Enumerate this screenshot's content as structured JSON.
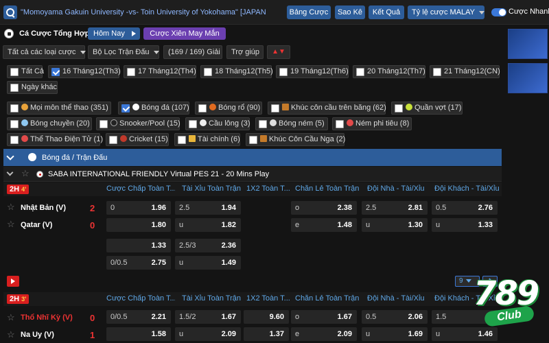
{
  "top": {
    "search_value": "\"Momoyama Gakuin University -vs- Toin University of Yokohama\" [JAPAN",
    "btn_bangcuoc": "Bảng Cược",
    "btn_saoke": "Sao Kê",
    "btn_ketqua": "Kết Quả",
    "btn_tyle": "Tỷ lệ cược MALAY",
    "toggle_label": "Cược Nhanh"
  },
  "menu": {
    "title": "Cá Cược Tổng Hợp",
    "today": "Hôm Nay",
    "parlay": "Cược Xiên May Mắn"
  },
  "filters": {
    "bet_types": "Tất cả các loại cược",
    "match_filter": "Bộ Lọc Trận Đấu",
    "count": "(169 / 169) Giải",
    "help": "Trợ giúp"
  },
  "dates": [
    "Tất Cả",
    "16 Tháng12(Th3)",
    "17 Tháng12(Th4)",
    "18 Tháng12(Th5)",
    "19 Tháng12(Th6)",
    "20 Tháng12(Th7)",
    "21 Tháng12(CN)",
    "Ngày khác"
  ],
  "sports": [
    "Mọi môn thể thao (351)",
    "Bóng đá (107)",
    "Bóng rổ (90)",
    "Khúc côn cầu trên băng (62)",
    "Quần vợt (17)",
    "Bóng chuyền (20)",
    "Snooker/Pool (15)",
    "Cầu lông (3)",
    "Bóng ném (5)",
    "Ném phi tiêu (8)",
    "Thể Thao Điện Tử (1)",
    "Cricket (15)",
    "Tài chính (6)",
    "Khúc Côn Cầu Nga (2)"
  ],
  "section": "Bóng đá / Trận Đấu",
  "league": "SABA INTERNATIONAL FRIENDLY Virtual PES 21 - 20 Mins Play",
  "columns": [
    "Cược Chấp Toàn T...",
    "Tài Xỉu Toàn Trận",
    "1X2 Toàn T...",
    "Chẵn Lẻ Toàn Trận",
    "Đội Nhà - Tài/Xỉu",
    "Đội Khách - Tài/Xỉu"
  ],
  "match1": {
    "status": "2H",
    "minute": "4'",
    "home": "Nhật Bản (V)",
    "away": "Qatar (V)",
    "home_score": "2",
    "away_score": "0",
    "r1": [
      [
        "0",
        "1.96"
      ],
      [
        "2.5",
        "1.94"
      ],
      [
        "o",
        "2.38"
      ],
      [
        "2.5",
        "2.81"
      ],
      [
        "0.5",
        "2.76"
      ]
    ],
    "r2": [
      [
        "",
        "1.80"
      ],
      [
        "u",
        "1.82"
      ],
      [
        "e",
        "1.48"
      ],
      [
        "u",
        "1.30"
      ],
      [
        "u",
        "1.33"
      ]
    ],
    "r3": [
      [
        "",
        "1.33"
      ],
      [
        "2.5/3",
        "2.36"
      ]
    ],
    "r4": [
      [
        "0/0.5",
        "2.75"
      ],
      [
        "u",
        "1.49"
      ]
    ]
  },
  "pager": "9",
  "match2": {
    "status": "2H",
    "minute": "3'",
    "home": "Thổ Nhĩ Kỳ (V)",
    "away": "Na Uy (V)",
    "home_score": "0",
    "away_score": "1",
    "r1": [
      [
        "0/0.5",
        "2.21"
      ],
      [
        "1.5/2",
        "1.67"
      ],
      [
        "",
        "9.60"
      ],
      [
        "o",
        "1.67"
      ],
      [
        "0.5",
        "2.06"
      ],
      [
        "1.5",
        ""
      ]
    ],
    "r2": [
      [
        "",
        "1.58"
      ],
      [
        "u",
        "2.09"
      ],
      [
        "",
        "1.37"
      ],
      [
        "e",
        "2.09"
      ],
      [
        "u",
        "1.69"
      ],
      [
        "u",
        "1.46"
      ]
    ]
  },
  "logo": {
    "num": "789",
    "club": "Club"
  }
}
